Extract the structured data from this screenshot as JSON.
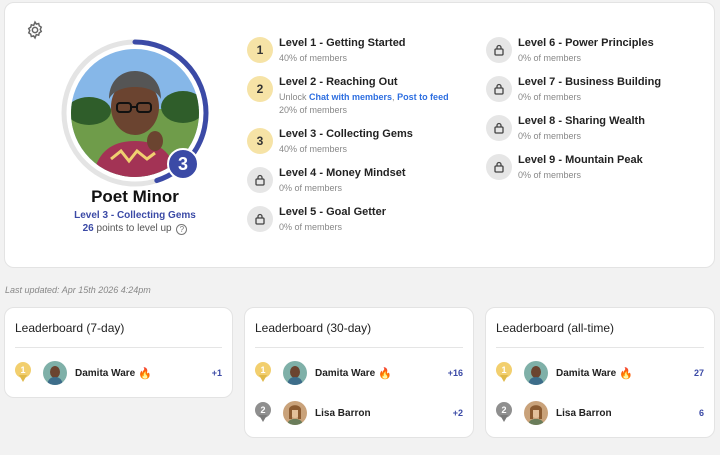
{
  "profile": {
    "name": "Poet Minor",
    "level_number": "3",
    "level_label": "Level 3 - Collecting Gems",
    "points_to_level_up": "26",
    "points_suffix": " points to level up",
    "help_symbol": "?",
    "level_progress_fraction": 0.45
  },
  "levels": [
    {
      "number": "1",
      "title": "Level 1 - Getting Started",
      "sub": "40% of members",
      "locked": false
    },
    {
      "number": "2",
      "title": "Level 2 - Reaching Out",
      "unlock_prefix": "Unlock ",
      "unlock_link_1": "Chat with members",
      "unlock_sep": ", ",
      "unlock_link_2": "Post to feed",
      "sub": " 20% of members",
      "locked": false
    },
    {
      "number": "3",
      "title": "Level 3 - Collecting Gems",
      "sub": "40% of members",
      "locked": false
    },
    {
      "number": "4",
      "title": "Level 4 - Money Mindset",
      "sub": "0% of members",
      "locked": true
    },
    {
      "number": "5",
      "title": "Level 5 - Goal Getter",
      "sub": "0% of members",
      "locked": true
    },
    {
      "number": "6",
      "title": "Level 6 - Power Principles",
      "sub": "0% of members",
      "locked": true
    },
    {
      "number": "7",
      "title": "Level 7 - Business Building",
      "sub": "0% of members",
      "locked": true
    },
    {
      "number": "8",
      "title": "Level 8 - Sharing Wealth",
      "sub": "0% of members",
      "locked": true
    },
    {
      "number": "9",
      "title": "Level 9 - Mountain Peak",
      "sub": "0% of members",
      "locked": true
    }
  ],
  "last_updated": "Last updated: Apr 15th 2026 4:24pm",
  "leaderboards": [
    {
      "title": "Leaderboard (7-day)",
      "rows": [
        {
          "rank": "1",
          "name": "Damita Ware",
          "points": "+1",
          "fire": true
        }
      ]
    },
    {
      "title": "Leaderboard (30-day)",
      "rows": [
        {
          "rank": "1",
          "name": "Damita Ware",
          "points": "+16",
          "fire": true
        },
        {
          "rank": "2",
          "name": "Lisa Barron",
          "points": "+2",
          "fire": false
        }
      ]
    },
    {
      "title": "Leaderboard (all-time)",
      "rows": [
        {
          "rank": "1",
          "name": "Damita Ware",
          "points": "27",
          "fire": true
        },
        {
          "rank": "2",
          "name": "Lisa Barron",
          "points": "6",
          "fire": false
        }
      ]
    }
  ],
  "icons": {
    "fire": "🔥",
    "settings": "gear-icon",
    "lock": "lock-icon"
  },
  "colors": {
    "accent": "#3b4aa6",
    "link": "#2d6ee0",
    "gold": "#f2cf6e",
    "silver": "#8f8f8f"
  }
}
